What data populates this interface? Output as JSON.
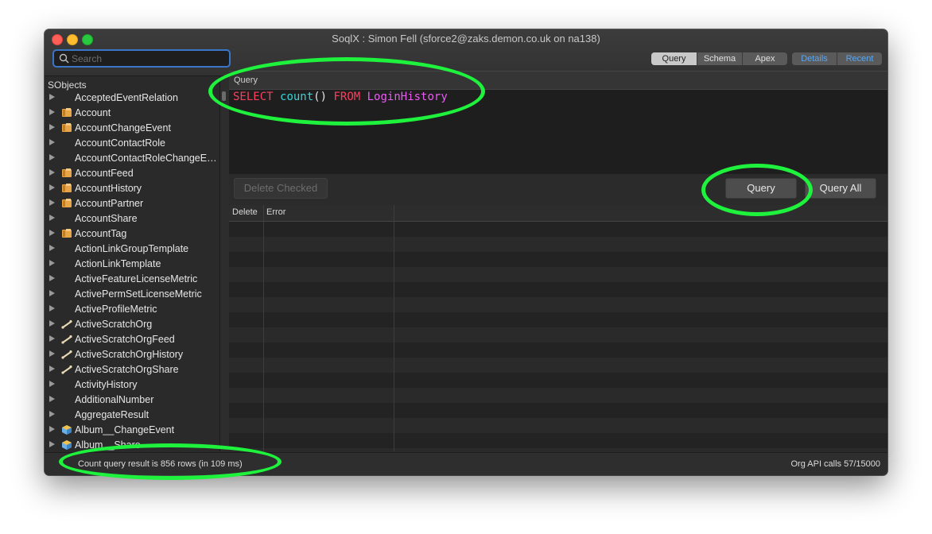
{
  "window": {
    "title": "SoqlX : Simon Fell (sforce2@zaks.demon.co.uk on na138)"
  },
  "search": {
    "placeholder": "Search"
  },
  "mode_tabs": {
    "items": [
      {
        "label": "Query",
        "selected": true
      },
      {
        "label": "Schema",
        "selected": false
      },
      {
        "label": "Apex",
        "selected": false
      }
    ]
  },
  "aux_tabs": {
    "items": [
      {
        "label": "Details"
      },
      {
        "label": "Recent"
      }
    ]
  },
  "sidebar": {
    "header": "SObjects",
    "items": [
      {
        "label": "AcceptedEventRelation",
        "icon": "none"
      },
      {
        "label": "Account",
        "icon": "book-icon"
      },
      {
        "label": "AccountChangeEvent",
        "icon": "book-icon"
      },
      {
        "label": "AccountContactRole",
        "icon": "none"
      },
      {
        "label": "AccountContactRoleChangeEv...",
        "icon": "none"
      },
      {
        "label": "AccountFeed",
        "icon": "book-icon"
      },
      {
        "label": "AccountHistory",
        "icon": "book-icon"
      },
      {
        "label": "AccountPartner",
        "icon": "book-icon"
      },
      {
        "label": "AccountShare",
        "icon": "none"
      },
      {
        "label": "AccountTag",
        "icon": "book-icon"
      },
      {
        "label": "ActionLinkGroupTemplate",
        "icon": "none"
      },
      {
        "label": "ActionLinkTemplate",
        "icon": "none"
      },
      {
        "label": "ActiveFeatureLicenseMetric",
        "icon": "none"
      },
      {
        "label": "ActivePermSetLicenseMetric",
        "icon": "none"
      },
      {
        "label": "ActiveProfileMetric",
        "icon": "none"
      },
      {
        "label": "ActiveScratchOrg",
        "icon": "bone-icon"
      },
      {
        "label": "ActiveScratchOrgFeed",
        "icon": "bone-icon"
      },
      {
        "label": "ActiveScratchOrgHistory",
        "icon": "bone-icon"
      },
      {
        "label": "ActiveScratchOrgShare",
        "icon": "bone-icon"
      },
      {
        "label": "ActivityHistory",
        "icon": "none"
      },
      {
        "label": "AdditionalNumber",
        "icon": "none"
      },
      {
        "label": "AggregateResult",
        "icon": "none"
      },
      {
        "label": "Album__ChangeEvent",
        "icon": "cube-icon"
      },
      {
        "label": "Album__Share",
        "icon": "cube-icon"
      }
    ]
  },
  "query": {
    "header": "Query",
    "tokens": {
      "select": "SELECT",
      "fn": "count",
      "parens": "()",
      "from": "FROM",
      "object": "LoginHistory"
    }
  },
  "actions": {
    "delete_checked": "Delete Checked",
    "query": "Query",
    "query_all": "Query All"
  },
  "results": {
    "columns": [
      "Delete",
      "Error"
    ]
  },
  "status": {
    "left": "Count query result is 856 rows (in 109 ms)",
    "right": "Org API calls 57/15000"
  },
  "colors": {
    "annotation": "#1ef23c",
    "accent": "#3a76c8",
    "link": "#5aa7ef"
  }
}
